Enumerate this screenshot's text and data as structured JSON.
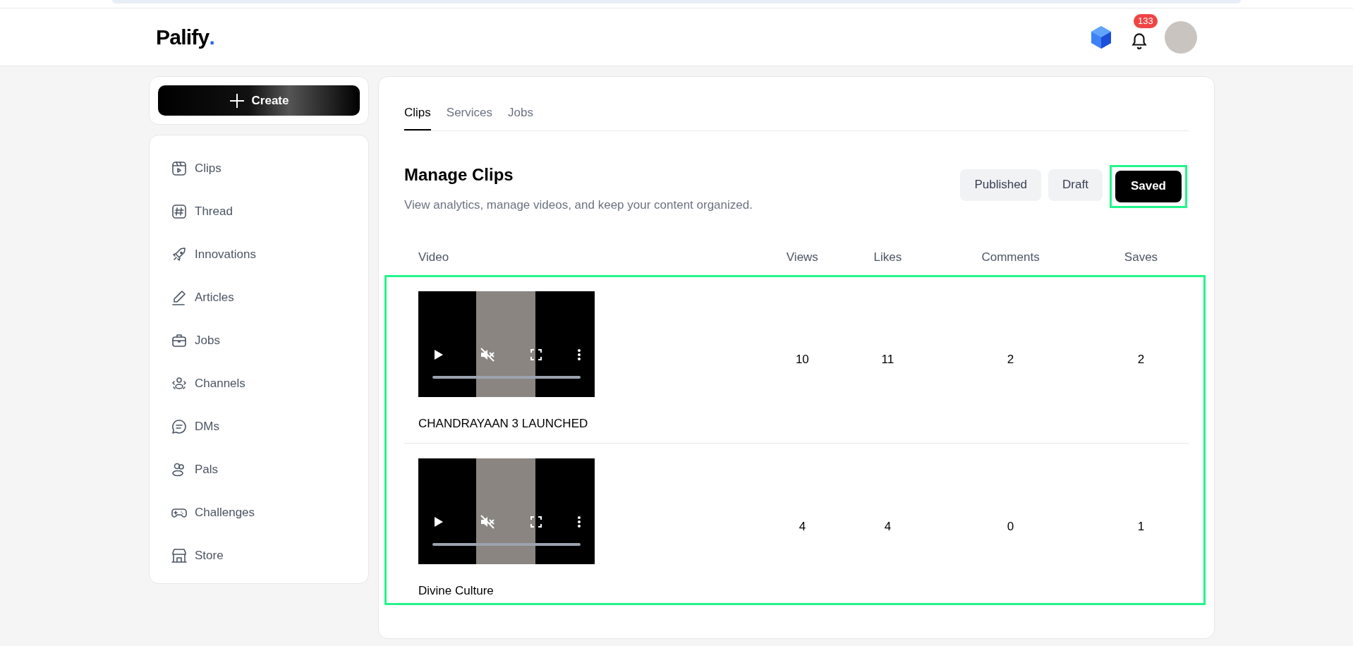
{
  "header": {
    "logo": "Palify",
    "logo_dot": ".",
    "notification_count": "133"
  },
  "create_button": {
    "label": "Create"
  },
  "sidebar": {
    "items": [
      {
        "label": "Clips"
      },
      {
        "label": "Thread"
      },
      {
        "label": "Innovations"
      },
      {
        "label": "Articles"
      },
      {
        "label": "Jobs"
      },
      {
        "label": "Channels"
      },
      {
        "label": "DMs"
      },
      {
        "label": "Pals"
      },
      {
        "label": "Challenges"
      },
      {
        "label": "Store"
      }
    ]
  },
  "tabs": [
    {
      "label": "Clips",
      "selected": true
    },
    {
      "label": "Services",
      "selected": false
    },
    {
      "label": "Jobs",
      "selected": false
    }
  ],
  "section": {
    "title": "Manage Clips",
    "subtitle": "View analytics, manage videos, and keep your content organized."
  },
  "filters": [
    {
      "label": "Published",
      "selected": false
    },
    {
      "label": "Draft",
      "selected": false
    },
    {
      "label": "Saved",
      "selected": true
    }
  ],
  "table": {
    "columns": [
      "Video",
      "Views",
      "Likes",
      "Comments",
      "Saves"
    ],
    "rows": [
      {
        "title": "CHANDRAYAAN 3 LAUNCHED",
        "views": "10",
        "likes": "11",
        "comments": "2",
        "saves": "2"
      },
      {
        "title": "Divine Culture",
        "views": "4",
        "likes": "4",
        "comments": "0",
        "saves": "1"
      }
    ]
  }
}
